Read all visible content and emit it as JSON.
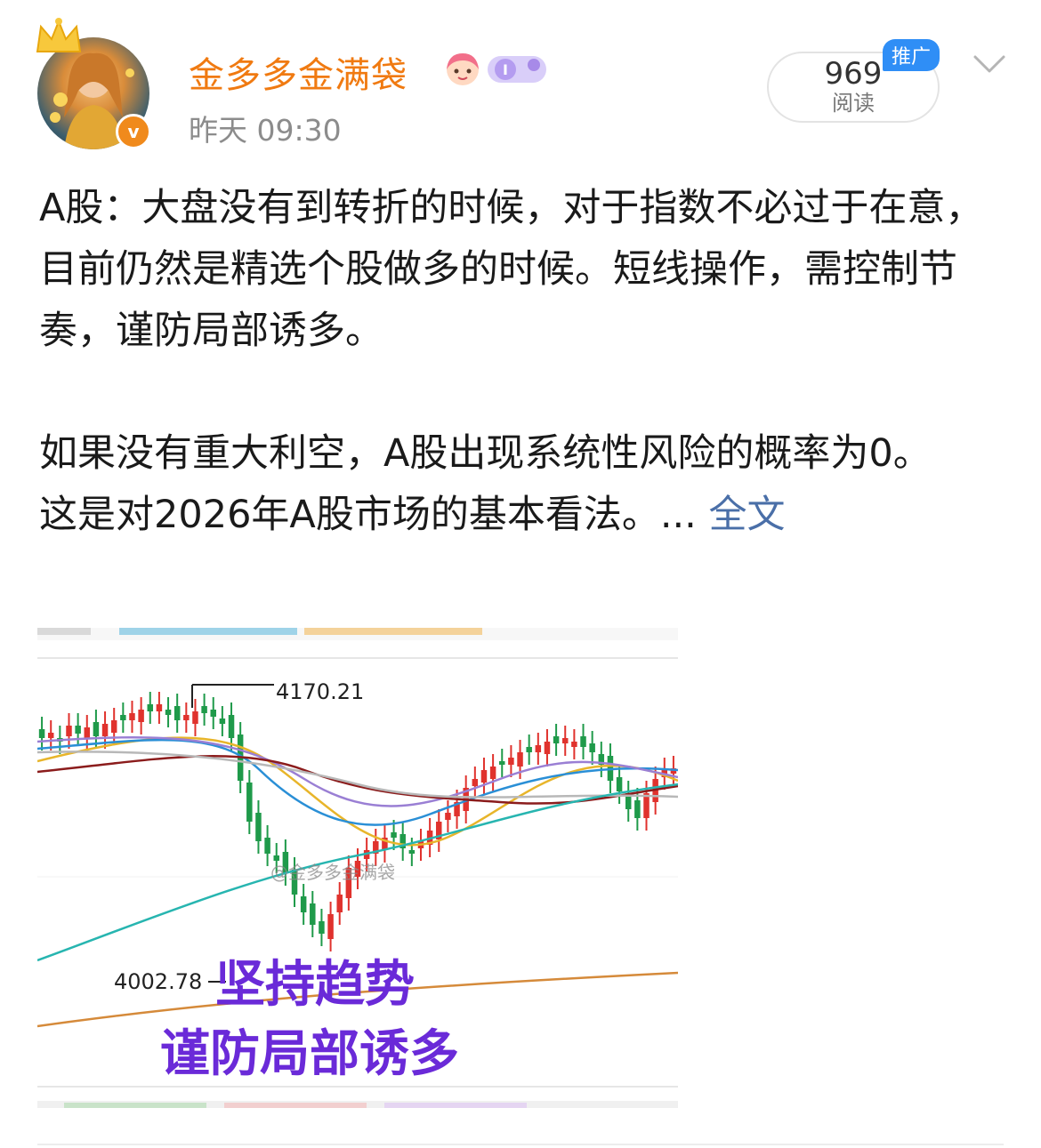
{
  "header": {
    "username": "金多多金满袋",
    "timestamp": "昨天 09:30",
    "verified_badge": "v",
    "reads": {
      "count": "969",
      "label": "阅读"
    },
    "promo_tag": "推广",
    "icons": [
      "crown-icon",
      "girl-emoji-icon",
      "level-badge-icon",
      "chevron-down-icon"
    ]
  },
  "post": {
    "paragraph1": "A股：大盘没有到转折的时候，对于指数不必过于在意，目前仍然是精选个股做多的时候。短线操作，需控制节奏，谨防局部诱多。",
    "paragraph2": "如果没有重大利空，A股出现系统性风险的概率为0。",
    "paragraph3": "这是对2026年A股市场的基本看法。...",
    "full_text_link": " 全文",
    "watermark": "@金多多金满袋"
  },
  "image": {
    "label_high": "4170.21",
    "label_low": "4002.78",
    "caption_line1": "坚持趋势",
    "caption_line2": "谨防局部诱多",
    "watermark": "@金多多金满袋",
    "colors": {
      "up": "#e0322d",
      "down": "#1f9a4a",
      "caption": "#6a2ad8"
    }
  }
}
